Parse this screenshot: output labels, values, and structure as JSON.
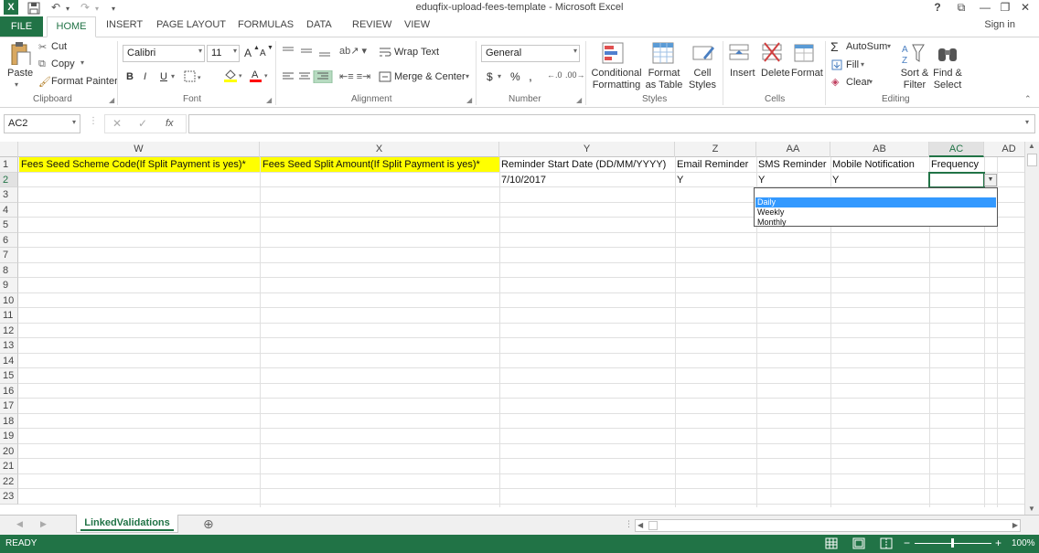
{
  "window": {
    "title": "eduqfix-upload-fees-template - Microsoft Excel",
    "help": "?",
    "restore_ribbon": "⧉",
    "minimize": "—",
    "maximize": "❐",
    "close": "✕"
  },
  "qat": {
    "save_icon": "save-icon",
    "undo": "↶",
    "redo": "↷",
    "customize": "▾"
  },
  "tabs": [
    "FILE",
    "HOME",
    "INSERT",
    "PAGE LAYOUT",
    "FORMULAS",
    "DATA",
    "REVIEW",
    "VIEW"
  ],
  "signin": "Sign in",
  "ribbon": {
    "clipboard": {
      "label": "Clipboard",
      "paste": "Paste",
      "cut": "Cut",
      "copy": "Copy",
      "format_painter": "Format Painter"
    },
    "font": {
      "label": "Font",
      "name": "Calibri",
      "size": "11",
      "bold": "B",
      "italic": "I",
      "underline": "U",
      "grow": "A",
      "shrink": "A"
    },
    "alignment": {
      "label": "Alignment",
      "wrap_text": "Wrap Text",
      "merge_center": "Merge & Center"
    },
    "number": {
      "label": "Number",
      "format": "General",
      "currency": "$",
      "percent": "%",
      "comma": ","
    },
    "styles": {
      "label": "Styles",
      "conditional": "Conditional Formatting",
      "format_table": "Format as Table",
      "cell_styles": "Cell Styles"
    },
    "cells": {
      "label": "Cells",
      "insert": "Insert",
      "delete": "Delete",
      "format": "Format"
    },
    "editing": {
      "label": "Editing",
      "autosum": "AutoSum",
      "fill": "Fill",
      "clear": "Clear",
      "sort_filter": "Sort & Filter",
      "find_select": "Find & Select"
    }
  },
  "formula_bar": {
    "name_box": "AC2",
    "fx": "fx",
    "formula": ""
  },
  "columns": [
    {
      "id": "W",
      "selected": false
    },
    {
      "id": "X",
      "selected": false
    },
    {
      "id": "Y",
      "selected": false
    },
    {
      "id": "Z",
      "selected": false
    },
    {
      "id": "AA",
      "selected": false
    },
    {
      "id": "AB",
      "selected": false
    },
    {
      "id": "AC",
      "selected": true
    },
    {
      "id": "AD",
      "selected": false
    }
  ],
  "rows": [
    "1",
    "2",
    "3",
    "4",
    "5",
    "6",
    "7",
    "8",
    "9",
    "10",
    "11",
    "12",
    "13",
    "14",
    "15",
    "16",
    "17",
    "18",
    "19",
    "20",
    "21",
    "22",
    "23"
  ],
  "row1": [
    "Fees Seed Scheme Code(If Split Payment is yes)*",
    "Fees Seed Split Amount(If Split Payment is yes)*",
    "Reminder Start Date (DD/MM/YYYY)",
    "Email Reminder",
    "SMS Reminder",
    "Mobile Notification",
    "Frequency"
  ],
  "row2": [
    "",
    "",
    "7/10/2017",
    "Y",
    "Y",
    "Y",
    ""
  ],
  "dropdown": {
    "options": [
      "Daily",
      "Weekly",
      "Monthly"
    ],
    "highlighted": "Daily"
  },
  "sheet": {
    "name": "LinkedValidations",
    "add": "⊕"
  },
  "status": {
    "mode": "READY",
    "zoom": "100%"
  },
  "colors": {
    "accent": "#217346",
    "header_fill": "#ffff00",
    "highlight": "#3399ff"
  }
}
